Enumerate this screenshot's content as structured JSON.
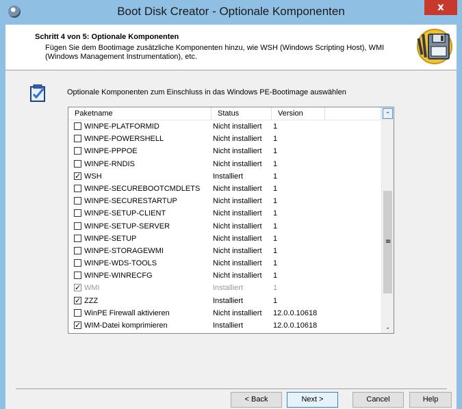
{
  "window": {
    "title": "Boot Disk Creator - Optionale Komponenten",
    "close_glyph": "x"
  },
  "header": {
    "step_title": "Schritt 4 von 5: Optionale Komponenten",
    "step_desc": "Fügen Sie dem Bootimage zusätzliche Komponenten hinzu, wie WSH (Windows Scripting Host), WMI (Windows Management Instrumentation), etc."
  },
  "section": {
    "label": "Optionale Komponenten zum Einschluss in das Windows PE-Bootimage auswählen"
  },
  "list": {
    "columns": [
      "Paketname",
      "Status",
      "Version"
    ],
    "rows": [
      {
        "name": "WINPE-PLATFORMID",
        "status": "Nicht installiert",
        "version": "1",
        "checked": false,
        "disabled": false
      },
      {
        "name": "WINPE-POWERSHELL",
        "status": "Nicht installiert",
        "version": "1",
        "checked": false,
        "disabled": false
      },
      {
        "name": "WINPE-PPPOE",
        "status": "Nicht installiert",
        "version": "1",
        "checked": false,
        "disabled": false
      },
      {
        "name": "WINPE-RNDIS",
        "status": "Nicht installiert",
        "version": "1",
        "checked": false,
        "disabled": false
      },
      {
        "name": "WSH",
        "status": "Installiert",
        "version": "1",
        "checked": true,
        "disabled": false
      },
      {
        "name": "WINPE-SECUREBOOTCMDLETS",
        "status": "Nicht installiert",
        "version": "1",
        "checked": false,
        "disabled": false
      },
      {
        "name": "WINPE-SECURESTARTUP",
        "status": "Nicht installiert",
        "version": "1",
        "checked": false,
        "disabled": false
      },
      {
        "name": "WINPE-SETUP-CLIENT",
        "status": "Nicht installiert",
        "version": "1",
        "checked": false,
        "disabled": false
      },
      {
        "name": "WINPE-SETUP-SERVER",
        "status": "Nicht installiert",
        "version": "1",
        "checked": false,
        "disabled": false
      },
      {
        "name": "WINPE-SETUP",
        "status": "Nicht installiert",
        "version": "1",
        "checked": false,
        "disabled": false
      },
      {
        "name": "WINPE-STORAGEWMI",
        "status": "Nicht installiert",
        "version": "1",
        "checked": false,
        "disabled": false
      },
      {
        "name": "WINPE-WDS-TOOLS",
        "status": "Nicht installiert",
        "version": "1",
        "checked": false,
        "disabled": false
      },
      {
        "name": "WINPE-WINRECFG",
        "status": "Nicht installiert",
        "version": "1",
        "checked": false,
        "disabled": false
      },
      {
        "name": "WMI",
        "status": "Installiert",
        "version": "1",
        "checked": true,
        "disabled": true
      },
      {
        "name": "ZZZ",
        "status": "Installiert",
        "version": "1",
        "checked": true,
        "disabled": false
      },
      {
        "name": "WinPE Firewall aktivieren",
        "status": "Nicht installiert",
        "version": "12.0.0.10618",
        "checked": false,
        "disabled": false
      },
      {
        "name": "WIM-Datei komprimieren",
        "status": "Installiert",
        "version": "12.0.0.10618",
        "checked": true,
        "disabled": false
      }
    ],
    "scroll_up_glyph": "⌃",
    "scroll_down_glyph": "⌄",
    "scroll_grip_glyph": "≡"
  },
  "buttons": {
    "back": "< Back",
    "next": "Next >",
    "cancel": "Cancel",
    "help": "Help"
  },
  "colors": {
    "titlebar": "#8fbfe3",
    "close": "#c7392c",
    "dialog_bg": "#f0f0f0"
  },
  "icons": {
    "app": "app-icon",
    "logo": "floppy-disk-logo-icon",
    "section": "checklist-icon"
  }
}
